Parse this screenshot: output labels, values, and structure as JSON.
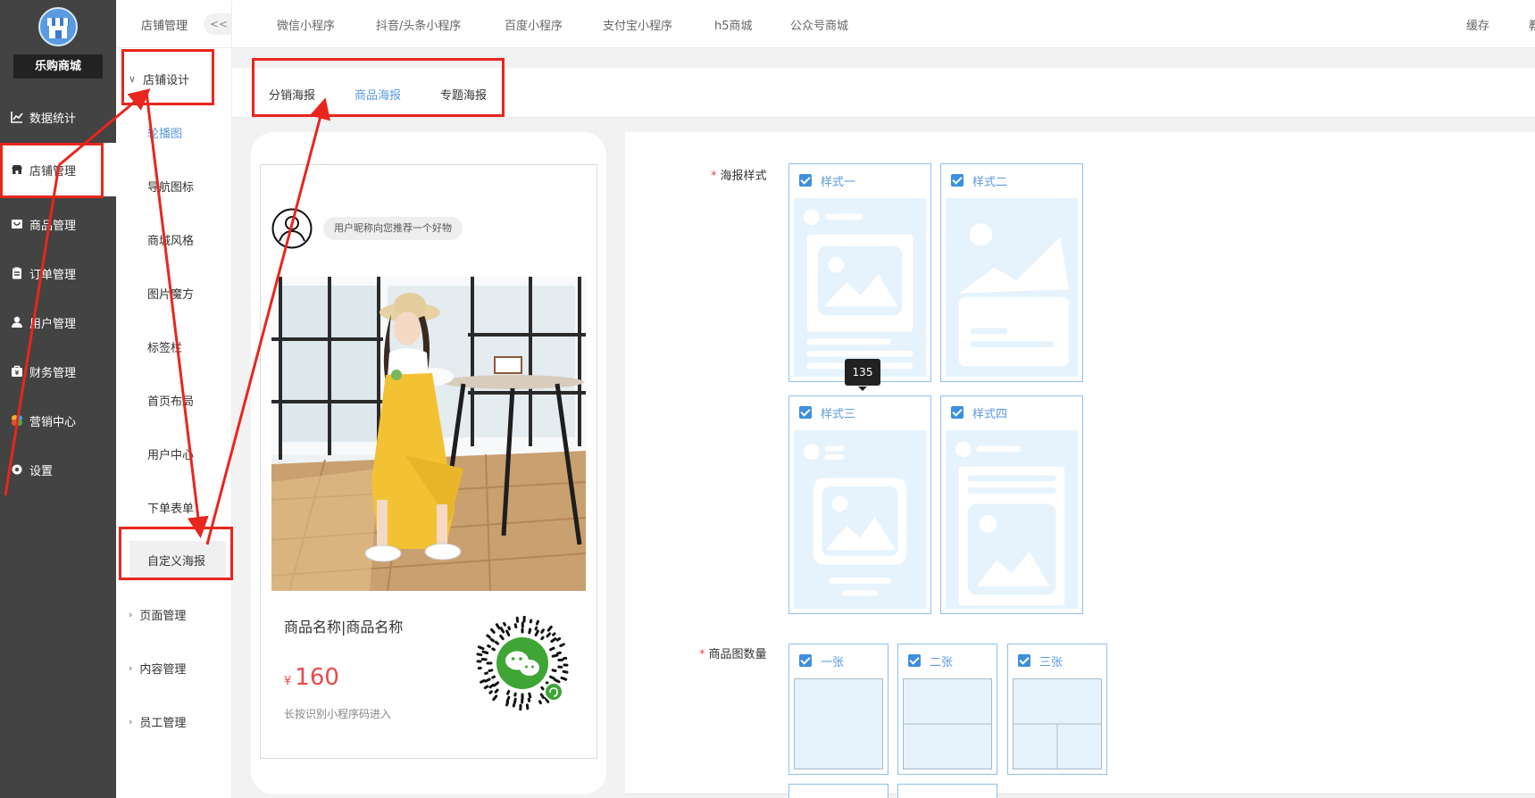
{
  "sidebar": {
    "brand": "乐购商城",
    "items": [
      {
        "label": "数据统计",
        "icon": "chart-line-icon"
      },
      {
        "label": "店铺管理",
        "icon": "store-icon"
      },
      {
        "label": "商品管理",
        "icon": "product-box-icon"
      },
      {
        "label": "订单管理",
        "icon": "clipboard-icon"
      },
      {
        "label": "用户管理",
        "icon": "user-icon"
      },
      {
        "label": "财务管理",
        "icon": "finance-bag-icon"
      },
      {
        "label": "营销中心",
        "icon": "marketing-colorful-icon"
      },
      {
        "label": "设置",
        "icon": "gear-icon"
      }
    ]
  },
  "subnav": {
    "header": "店铺管理",
    "collapse": "<<",
    "group_design": "店铺设计",
    "design_items": [
      "轮播图",
      "导航图标",
      "商城风格",
      "图片魔方",
      "标签栏",
      "首页布局",
      "用户中心",
      "下单表单",
      "自定义海报"
    ],
    "groups": [
      "页面管理",
      "内容管理",
      "员工管理"
    ]
  },
  "topbar": {
    "tabs": [
      "微信小程序",
      "抖音/头条小程序",
      "百度小程序",
      "支付宝小程序",
      "h5商城",
      "公众号商城"
    ],
    "cache": "缓存",
    "cut": "教"
  },
  "poster_tabs": [
    "分销海报",
    "商品海报",
    "专题海报"
  ],
  "preview": {
    "recommend": "用户昵称向您推荐一个好物",
    "product_name": "商品名称|商品名称",
    "currency": "¥",
    "price": "160",
    "hint": "长按识别小程序码进入"
  },
  "form": {
    "style_label": "海报样式",
    "styles": [
      "样式一",
      "样式二",
      "样式三",
      "样式四"
    ],
    "tooltip": "135",
    "count_label": "商品图数量",
    "counts": [
      "一张",
      "二张",
      "三张"
    ]
  },
  "colors": {
    "accent": "#5a9ae0",
    "sidebar": "#434343",
    "price": "#e84a4a",
    "annotation": "#e8261e"
  }
}
